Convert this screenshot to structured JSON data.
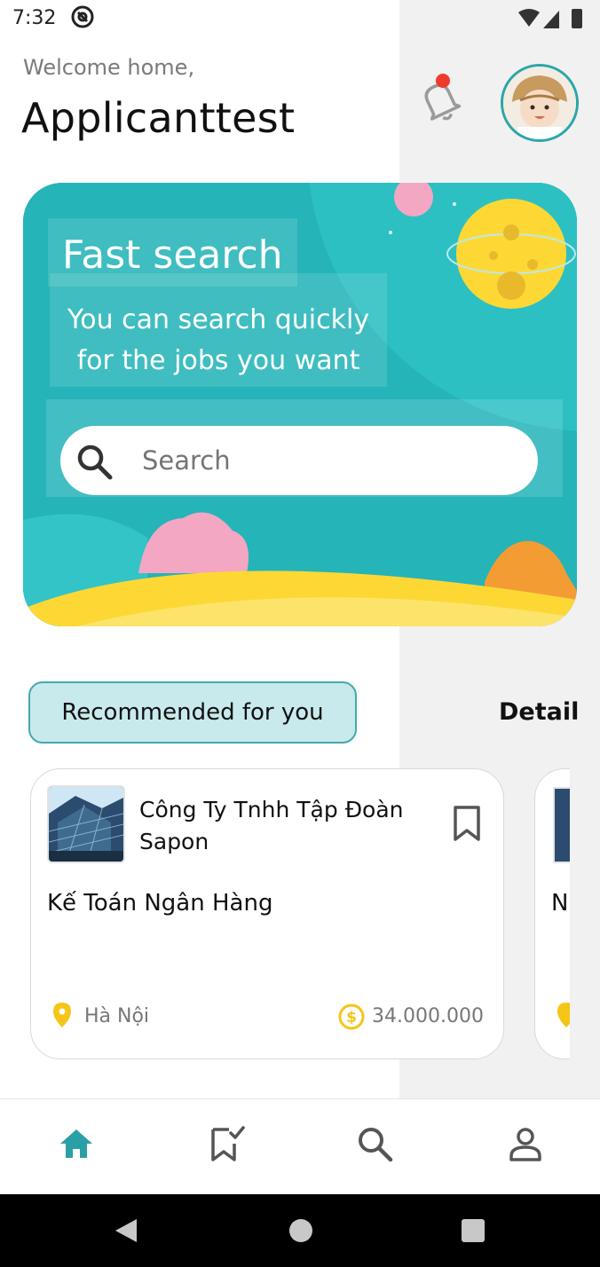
{
  "status_bar": {
    "time": "7:32"
  },
  "header": {
    "welcome": "Welcome home,",
    "username": "Applicanttest"
  },
  "banner": {
    "title": "Fast search",
    "subtitle_line1": "You can search quickly",
    "subtitle_line2": "for the jobs you want",
    "search_placeholder": "Search"
  },
  "recommended": {
    "label": "Recommended for you",
    "detail_link": "Detail"
  },
  "jobs": [
    {
      "company_line1": "Công Ty Tnhh Tập Đoàn",
      "company_line2": "Sapon",
      "title": "Kế Toán Ngân Hàng",
      "location": "Hà Nội",
      "salary": "34.000.000"
    },
    {
      "title_partial": "N"
    }
  ],
  "bottom_nav": [
    "home-icon",
    "saved-jobs-icon",
    "search-icon",
    "profile-icon"
  ],
  "colors": {
    "accent": "#2a9fa5",
    "banner": "#25b4b8",
    "chip_bg": "#c9eaec",
    "notification_dot": "#ef3b2c",
    "pin": "#f5c518"
  }
}
